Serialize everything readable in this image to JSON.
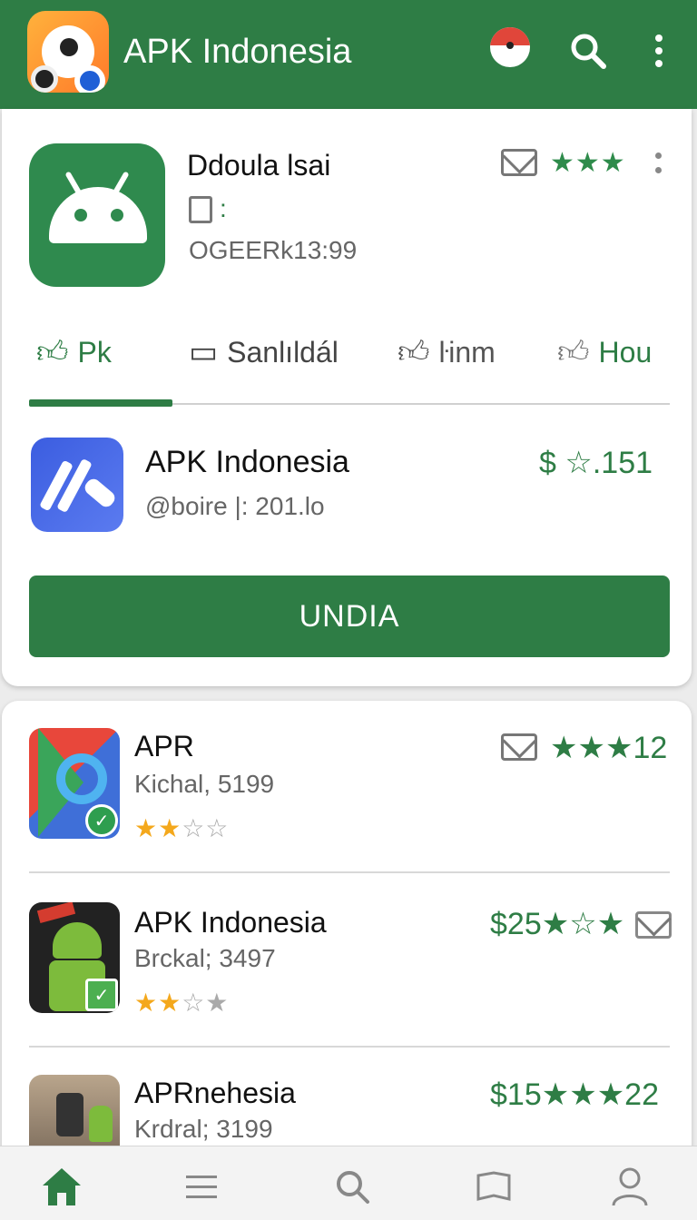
{
  "app": {
    "title": "APK Indonesia"
  },
  "featured": {
    "name": "Ddoula lsai",
    "sub_icon_text": ":",
    "meta": "OGEERk13:99",
    "stars": "★★★",
    "tabs": [
      {
        "label": "Pk"
      },
      {
        "label": "Sanlıldál"
      },
      {
        "label": "ŀinm"
      },
      {
        "label": "Hou"
      }
    ],
    "app_name": "APK Indonesia",
    "app_sub": "@boire |: 201.lo",
    "price_rating": "$ ☆.151",
    "button_label": "UNDIA"
  },
  "list": [
    {
      "name": "APR",
      "sub": "Kichal, 5199",
      "right": "★★★12",
      "rating_on": 2,
      "rating_total": 4
    },
    {
      "name": "APK Indonesia",
      "sub": "Brckal; 3497",
      "right": "$25★☆★",
      "rating_on": 2,
      "rating_total": 4
    },
    {
      "name": "APRnehesia",
      "sub": "Krdral; 3199",
      "right": "$15★★★22"
    }
  ],
  "colors": {
    "brand_green": "#2e7d45",
    "star_yellow": "#f4a81c"
  },
  "icons": [
    "app-logo-icon",
    "pacman-icon",
    "search-icon",
    "more-vert-icon",
    "mail-icon",
    "home-icon",
    "menu-icon",
    "bookmark-icon",
    "profile-icon"
  ]
}
